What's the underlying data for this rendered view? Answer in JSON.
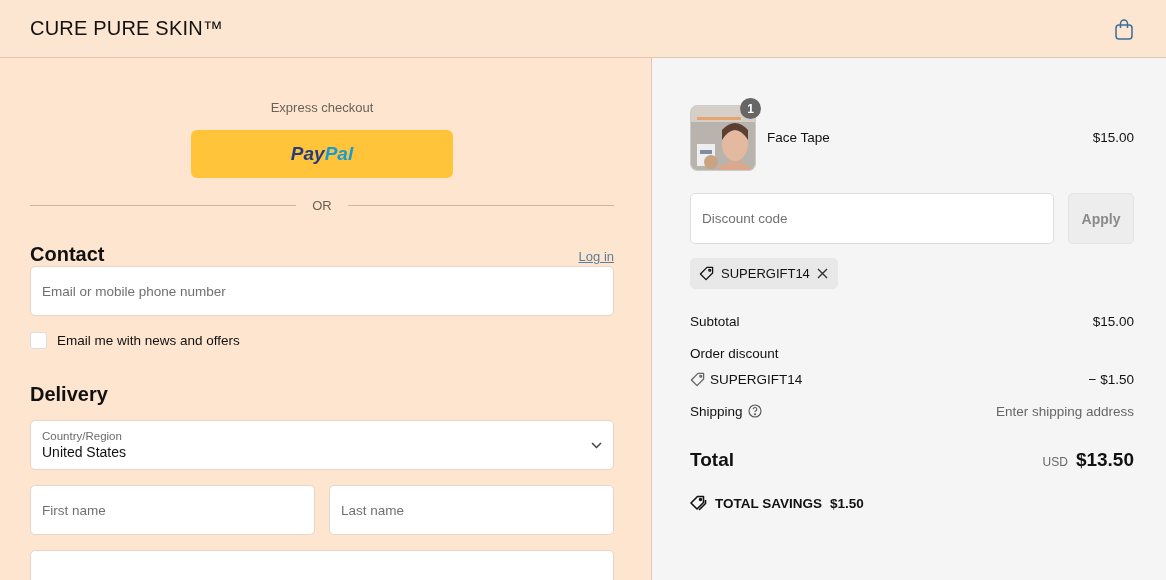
{
  "header": {
    "brand": "CURE PURE SKIN™"
  },
  "express": {
    "title": "Express checkout",
    "paypal": {
      "part_1": "Pay",
      "part_2": "Pal"
    },
    "divider": "OR"
  },
  "contact": {
    "heading": "Contact",
    "login_link": "Log in",
    "email": {
      "placeholder": "Email or mobile phone number"
    },
    "newsletter": {
      "label": "Email me with news and offers",
      "checked": false
    }
  },
  "delivery": {
    "heading": "Delivery",
    "country": {
      "label": "Country/Region",
      "value": "United States"
    },
    "first_name": {
      "placeholder": "First name"
    },
    "last_name": {
      "placeholder": "Last name"
    }
  },
  "summary": {
    "items": [
      {
        "name": "Face Tape",
        "price": "$15.00",
        "quantity": "1",
        "kind": "picture"
      }
    ],
    "discount": {
      "placeholder": "Discount code",
      "button": "Apply"
    },
    "applied_codes": [
      {
        "code": "SUPERGIFT14"
      }
    ],
    "lines": [
      {
        "kind": "amount",
        "label": "Subtotal",
        "value": "$15.00"
      },
      {
        "kind": "discount",
        "label": "Order discount",
        "code": "SUPERGIFT14",
        "value": "− $1.50"
      },
      {
        "kind": "shipping",
        "label": "Shipping",
        "value": "Enter shipping address"
      }
    ],
    "total": {
      "label": "Total",
      "currency": "USD",
      "value": "$13.50"
    },
    "savings": {
      "label": "TOTAL SAVINGS",
      "value": "$1.50"
    }
  }
}
